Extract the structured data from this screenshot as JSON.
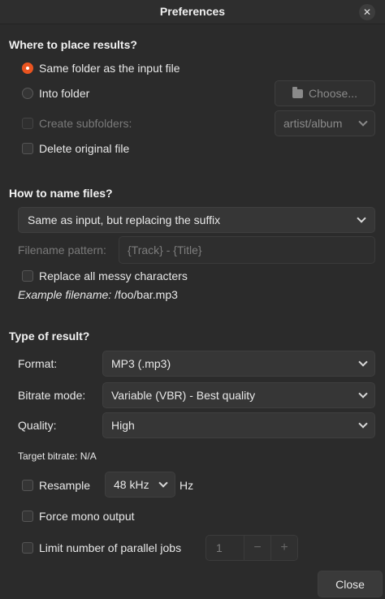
{
  "window": {
    "title": "Preferences"
  },
  "placement": {
    "heading": "Where to place results?",
    "same_folder": "Same folder as the input file",
    "into_folder": "Into folder",
    "choose_button": "Choose...",
    "create_subfolders": "Create subfolders:",
    "subfolder_pattern": "artist/album",
    "delete_original": "Delete original file"
  },
  "naming": {
    "heading": "How to name files?",
    "mode": "Same as input, but replacing the suffix",
    "pattern_label": "Filename pattern:",
    "pattern_value": "{Track} - {Title}",
    "replace_messy": "Replace all messy characters",
    "example_label": "Example filename:",
    "example_value": "/foo/bar.mp3"
  },
  "result": {
    "heading": "Type of result?",
    "format_label": "Format:",
    "format_value": "MP3 (.mp3)",
    "bitrate_mode_label": "Bitrate mode:",
    "bitrate_mode_value": "Variable (VBR) - Best quality",
    "quality_label": "Quality:",
    "quality_value": "High",
    "target_bitrate": "Target bitrate: N/A",
    "resample_label": "Resample",
    "resample_rate": "48 kHz",
    "resample_unit": "Hz",
    "force_mono": "Force mono output",
    "limit_jobs": "Limit number of parallel jobs",
    "jobs_value": "1",
    "minus": "−",
    "plus": "+"
  },
  "footer": {
    "close_button": "Close"
  },
  "colors": {
    "accent": "#e95420",
    "background": "#2b2b2b"
  }
}
